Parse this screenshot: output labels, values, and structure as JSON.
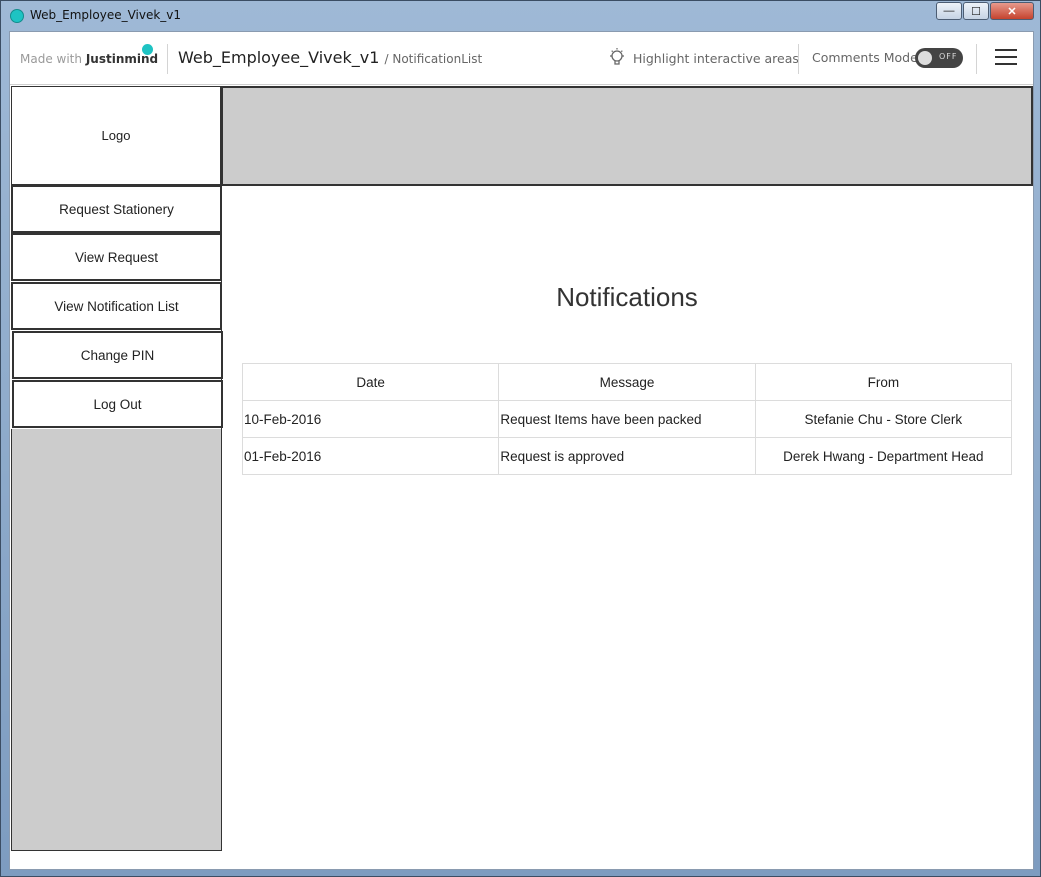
{
  "window": {
    "title": "Web_Employee_Vivek_v1",
    "buttons": {
      "minimize": "—",
      "maximize": "☐",
      "close": "✕"
    }
  },
  "header": {
    "made_with": "Made with",
    "brand": "Justinmind",
    "project": "Web_Employee_Vivek_v1",
    "page": "/ NotificationList",
    "highlight_label": "Highlight interactive areas",
    "comments_label": "Comments Mode",
    "toggle_state": "OFF"
  },
  "sidebar": {
    "logo": "Logo",
    "items": [
      {
        "label": "Request Stationery"
      },
      {
        "label": "View Request"
      },
      {
        "label": "View Notification List"
      },
      {
        "label": "Change PIN"
      },
      {
        "label": "Log Out"
      }
    ]
  },
  "main": {
    "title": "Notifications",
    "columns": [
      "Date",
      "Message",
      "From"
    ],
    "rows": [
      {
        "date": "10-Feb-2016",
        "message": "Request Items have been packed",
        "from": "Stefanie Chu - Store Clerk"
      },
      {
        "date": "01-Feb-2016",
        "message": "Request is approved",
        "from": "Derek Hwang - Department Head"
      }
    ]
  },
  "colors": {
    "accent": "#1ec3c3",
    "banner": "#cccccc",
    "border": "#333333"
  }
}
